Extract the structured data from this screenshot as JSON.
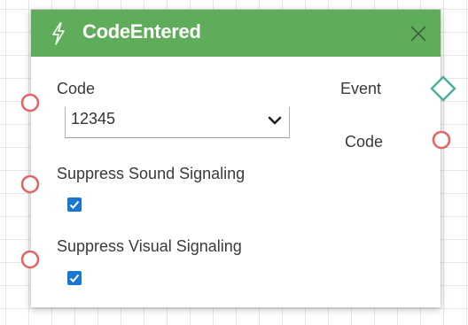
{
  "node": {
    "title": "CodeEntered",
    "icon": "bolt-icon",
    "header_color": "#5fad5a",
    "port_color": "#e06666",
    "event_port_color": "#4caf9a",
    "checkbox_color": "#1976d2",
    "inputs": {
      "code_label": "Code",
      "code_value": "12345",
      "suppress_sound_label": "Suppress Sound Signaling",
      "suppress_sound_checked": true,
      "suppress_visual_label": "Suppress Visual Signaling",
      "suppress_visual_checked": true
    },
    "outputs": {
      "event_label": "Event",
      "code_label": "Code"
    }
  }
}
